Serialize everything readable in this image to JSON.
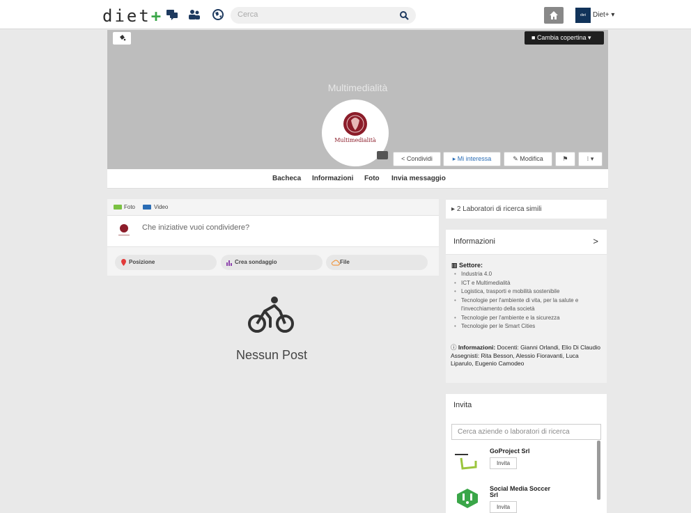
{
  "header": {
    "logo_text": "diet",
    "logo_plus": "+",
    "search_placeholder": "Cerca",
    "user_avatar_text": "diet",
    "user_name": "Diet+ ▾"
  },
  "cover": {
    "change_cover_label": "Cambia copertina ▾",
    "title": "Multimedialità",
    "logo_label": "Multimedialità"
  },
  "actions": {
    "share": "Condividi",
    "interested": "Mi interessa",
    "edit": "Modifica",
    "more": "⁝ ▾"
  },
  "tabs": [
    "Bacheca",
    "Informazioni",
    "Foto",
    "Invia messaggio"
  ],
  "composer": {
    "photo_label": "Foto",
    "video_label": "Video",
    "prompt": "Che iniziative vuoi condividere?",
    "position_label": "Posizione",
    "poll_label": "Crea sondaggio",
    "file_label": "File"
  },
  "feed": {
    "empty_label": "Nessun Post"
  },
  "sidebar": {
    "similar_label": "2 Laboratori di ricerca simili",
    "info_title": "Informazioni",
    "info_chevron": ">",
    "sector_label": "Settore:",
    "sectors": [
      "Industria 4.0",
      "ICT e Multimedialità",
      "Logistica, trasporti e mobilità sostenibile",
      "Tecnologie per l'ambiente di vita, per la salute e l'invecchiamento della società",
      "Tecnologie per l'ambiente e la sicurezza",
      "Tecnologie per le Smart Cities"
    ],
    "people_label": "Informazioni:",
    "people_text": "Docenti: Gianni Orlandi, Elio Di Claudio",
    "assignees_text": "Assegnisti: Rita Besson, Alessio Fioravanti, Luca Liparulo, Eugenio Camodeo",
    "invite_title": "Invita",
    "invite_placeholder": "Cerca aziende o laboratori di ricerca",
    "companies": [
      {
        "name": "GoProject Srl",
        "button": "Invita"
      },
      {
        "name": "Social Media Soccer Srl",
        "button": "Invita"
      }
    ]
  },
  "colors": {
    "accent_green": "#3aa648",
    "link_blue": "#2a6db5",
    "university_red": "#8c1d2a"
  }
}
